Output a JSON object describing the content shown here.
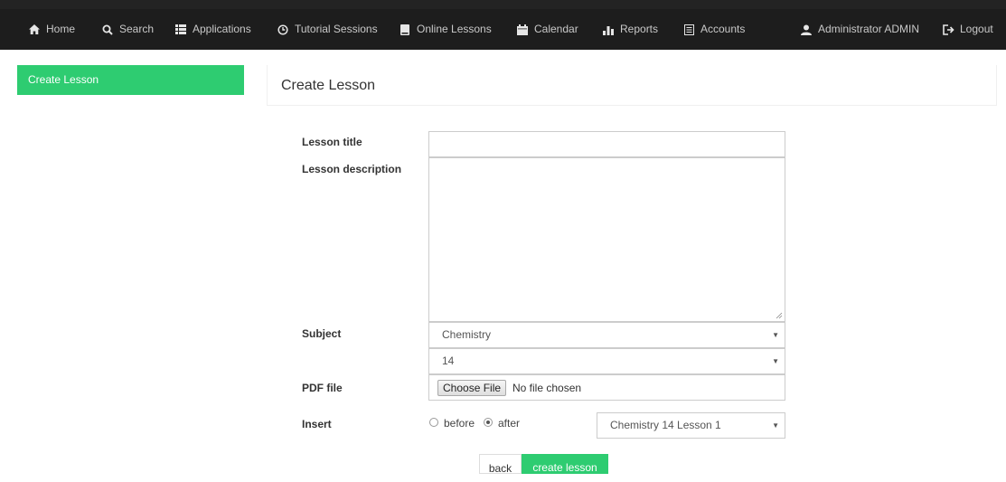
{
  "nav": {
    "home": "Home",
    "search": "Search",
    "applications": "Applications",
    "tutorial_sessions": "Tutorial Sessions",
    "online_lessons": "Online Lessons",
    "calendar": "Calendar",
    "reports": "Reports",
    "accounts": "Accounts",
    "user": "Administrator ADMIN",
    "logout": "Logout"
  },
  "sidebar": {
    "create_lesson": "Create Lesson"
  },
  "page": {
    "title": "Create Lesson"
  },
  "form": {
    "lesson_title_label": "Lesson title",
    "lesson_title_value": "",
    "lesson_description_label": "Lesson description",
    "lesson_description_value": "",
    "subject_label": "Subject",
    "subject_value": "Chemistry",
    "level_value": "14",
    "pdf_label": "PDF file",
    "choose_file": "Choose File",
    "no_file": "No file chosen",
    "insert_label": "Insert",
    "before": "before",
    "after": "after",
    "insert_selected": "after",
    "lesson_position_value": "Chemistry 14 Lesson 1"
  },
  "buttons": {
    "back": "back",
    "create": "create lesson"
  },
  "colors": {
    "accent": "#2ecc71",
    "navbar": "#1d1d1d"
  }
}
